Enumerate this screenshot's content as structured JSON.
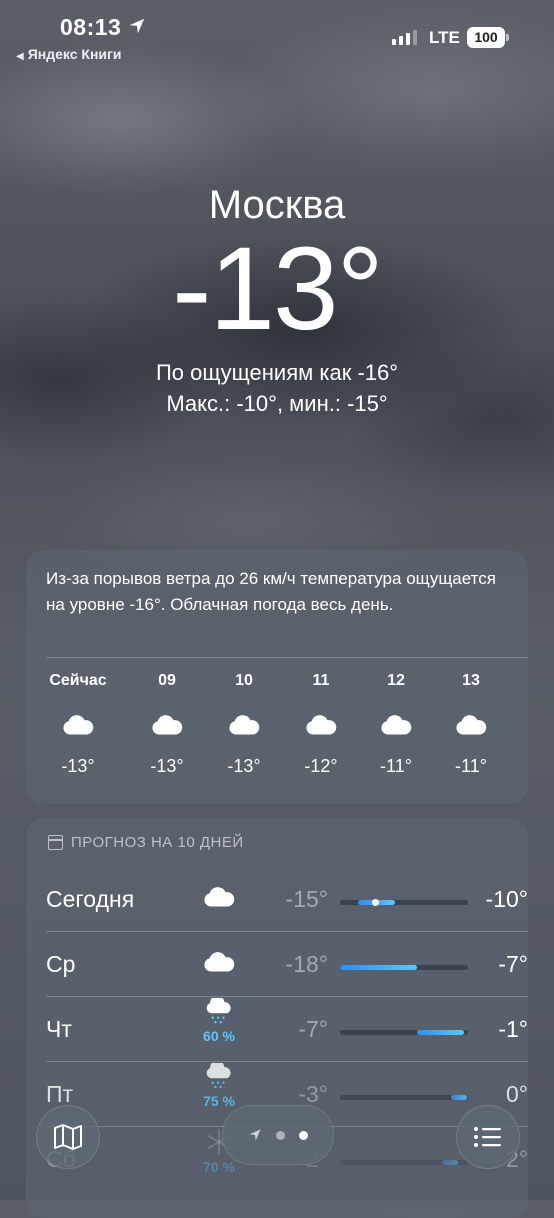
{
  "status_bar": {
    "time": "08:13",
    "back_app": "Яндекс Книги",
    "network": "LTE",
    "battery": "100"
  },
  "current": {
    "city": "Москва",
    "temperature": "-13°",
    "feels_like": "По ощущениям как -16°",
    "high_low": "Макс.: -10°, мин.: -15°"
  },
  "summary": "Из-за порывов ветра до 26 км/ч температура ощущается на уровне -16°. Облачная погода весь день.",
  "hourly": [
    {
      "label": "Сейчас",
      "icon": "cloud-icon",
      "temp": "-13°"
    },
    {
      "label": "09",
      "icon": "cloud-icon",
      "temp": "-13°"
    },
    {
      "label": "10",
      "icon": "cloud-icon",
      "temp": "-13°"
    },
    {
      "label": "11",
      "icon": "cloud-icon",
      "temp": "-12°"
    },
    {
      "label": "12",
      "icon": "cloud-icon",
      "temp": "-11°"
    },
    {
      "label": "13",
      "icon": "cloud-icon",
      "temp": "-11°"
    }
  ],
  "forecast": {
    "header": "ПРОГНОЗ НА 10 ДНЕЙ",
    "days": [
      {
        "day": "Сегодня",
        "icon": "cloud-icon",
        "precip": "",
        "low": "-15°",
        "high": "-10°",
        "range_start": 0.14,
        "range_end": 0.43,
        "current_marker": 0.27
      },
      {
        "day": "Ср",
        "icon": "cloud-icon",
        "precip": "",
        "low": "-18°",
        "high": "-7°",
        "range_start": 0.0,
        "range_end": 0.6
      },
      {
        "day": "Чт",
        "icon": "cloud-snow-icon",
        "precip": "60 %",
        "low": "-7°",
        "high": "-1°",
        "range_start": 0.6,
        "range_end": 0.97
      },
      {
        "day": "Пт",
        "icon": "cloud-snow-icon",
        "precip": "75 %",
        "low": "-3°",
        "high": "0°",
        "range_start": 0.87,
        "range_end": 0.99
      },
      {
        "day": "Сб",
        "icon": "snowflake-icon",
        "precip": "70 %",
        "low": "-2°",
        "high": "2°",
        "range_start": 0.8,
        "range_end": 0.92
      }
    ]
  },
  "bottom_bar": {
    "map": "map-icon",
    "list": "list-icon",
    "pages": [
      "location-arrow-icon",
      "page-dot",
      "page-dot-active"
    ]
  }
}
